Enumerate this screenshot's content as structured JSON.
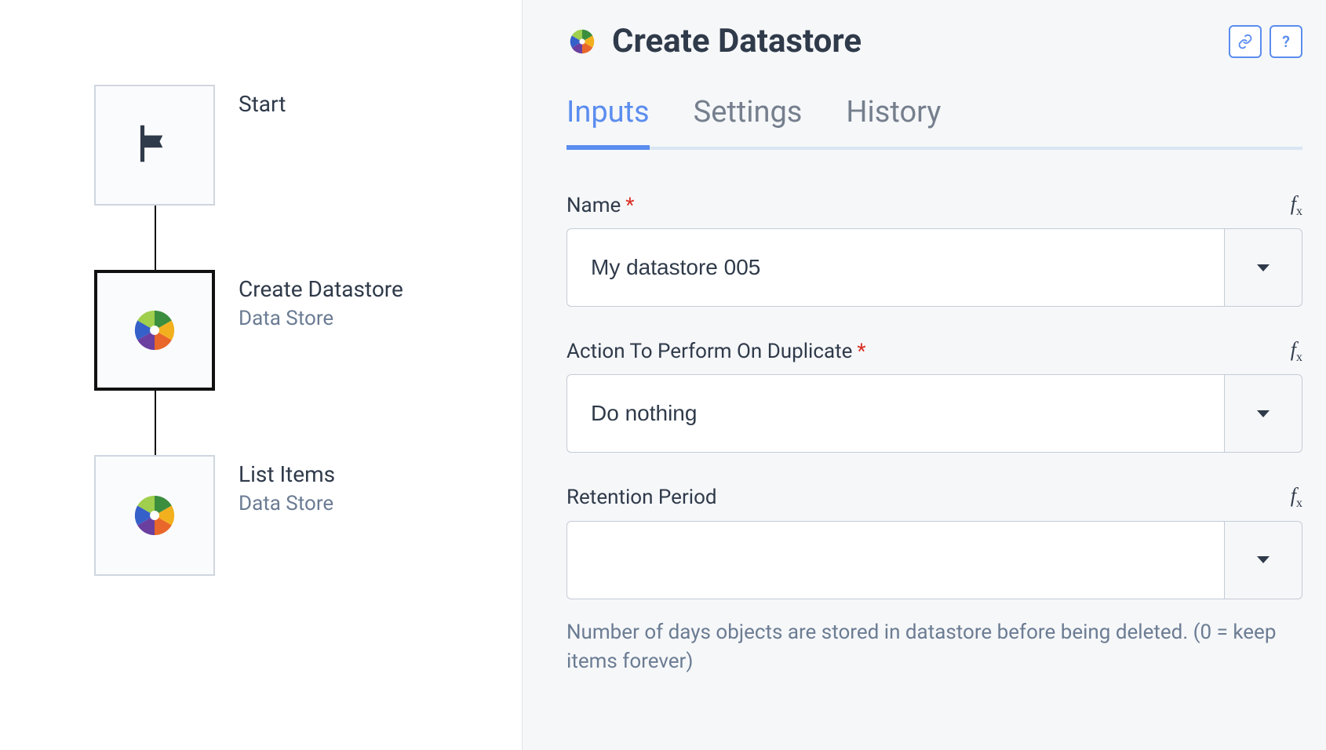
{
  "flow": {
    "nodes": [
      {
        "title": "Start",
        "subtitle": ""
      },
      {
        "title": "Create Datastore",
        "subtitle": "Data Store"
      },
      {
        "title": "List Items",
        "subtitle": "Data Store"
      }
    ]
  },
  "header": {
    "title": "Create Datastore"
  },
  "tabs": {
    "inputs": "Inputs",
    "settings": "Settings",
    "history": "History"
  },
  "form": {
    "name_label": "Name",
    "name_value": "My datastore 005",
    "dup_label": "Action To Perform On Duplicate",
    "dup_value": "Do nothing",
    "retention_label": "Retention Period",
    "retention_value": "",
    "retention_help": "Number of days objects are stored in datastore before being deleted. (0 = keep items forever)"
  }
}
